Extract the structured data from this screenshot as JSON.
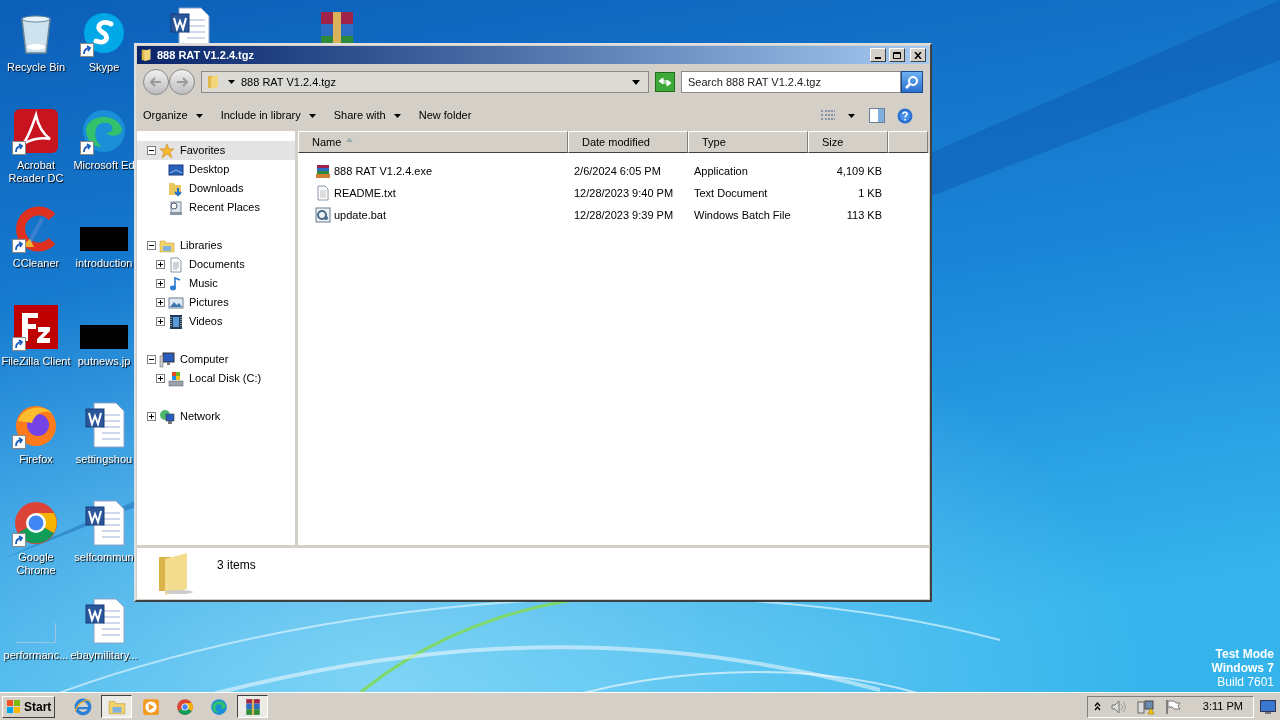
{
  "desktop": {
    "icons": [
      {
        "label": "Recycle Bin",
        "kind": "recycle-bin",
        "shortcut": false
      },
      {
        "label": "Skype",
        "kind": "skype",
        "shortcut": true
      },
      {
        "label": "Acrobat Reader DC",
        "kind": "acrobat",
        "shortcut": true
      },
      {
        "label": "Microsoft Ed",
        "kind": "edge",
        "shortcut": true
      },
      {
        "label": "CCleaner",
        "kind": "ccleaner",
        "shortcut": true
      },
      {
        "label": "introduction",
        "kind": "black",
        "shortcut": false
      },
      {
        "label": "FileZilla Client",
        "kind": "filezilla",
        "shortcut": true
      },
      {
        "label": "putnews.jp",
        "kind": "black",
        "shortcut": false
      },
      {
        "label": "Firefox",
        "kind": "firefox",
        "shortcut": true
      },
      {
        "label": "settingshou",
        "kind": "word",
        "shortcut": false
      },
      {
        "label": "Google Chrome",
        "kind": "chrome",
        "shortcut": true
      },
      {
        "label": "selfcommun",
        "kind": "word",
        "shortcut": false
      },
      {
        "label": "performanc...",
        "kind": "blank",
        "shortcut": false
      },
      {
        "label": "ebaymilitary...",
        "kind": "word",
        "shortcut": false
      }
    ],
    "covered_icons": [
      {
        "kind": "word"
      },
      {
        "kind": "winrar"
      }
    ],
    "os_notice": [
      {
        "text": "Test Mode",
        "bold": true
      },
      {
        "text": "Windows 7",
        "bold": true
      },
      {
        "text": "Build 7601",
        "bold": false
      }
    ]
  },
  "window": {
    "title": "888 RAT V1.2.4.tgz",
    "address": "888 RAT V1.2.4.tgz",
    "search": {
      "placeholder": "Search 888 RAT V1.2.4.tgz"
    },
    "toolbar": [
      {
        "label": "Organize",
        "menu": true
      },
      {
        "label": "Include in library",
        "menu": true
      },
      {
        "label": "Share with",
        "menu": true
      },
      {
        "label": "New folder",
        "menu": false
      }
    ],
    "tree": [
      {
        "label": "Favorites",
        "kind": "star",
        "expanded": true,
        "selected": true,
        "children": [
          {
            "label": "Desktop",
            "kind": "desktop",
            "selected": false
          },
          {
            "label": "Downloads",
            "kind": "downloads",
            "selected": false
          },
          {
            "label": "Recent Places",
            "kind": "recent",
            "selected": false
          }
        ]
      },
      {
        "label": "Libraries",
        "kind": "libraries",
        "expanded": true,
        "selected": false,
        "children": [
          {
            "label": "Documents",
            "kind": "documents",
            "expanded": false,
            "selected": false
          },
          {
            "label": "Music",
            "kind": "music",
            "expanded": false,
            "selected": false
          },
          {
            "label": "Pictures",
            "kind": "pictures",
            "expanded": false,
            "selected": false
          },
          {
            "label": "Videos",
            "kind": "videos",
            "expanded": false,
            "selected": false
          }
        ]
      },
      {
        "label": "Computer",
        "kind": "computer",
        "expanded": true,
        "selected": false,
        "children": [
          {
            "label": "Local Disk (C:)",
            "kind": "disk",
            "expanded": false,
            "selected": false
          }
        ]
      },
      {
        "label": "Network",
        "kind": "network",
        "expanded": false,
        "selected": false
      }
    ],
    "columns": [
      {
        "label": "Name",
        "sorted": true
      },
      {
        "label": "Date modified",
        "sorted": false
      },
      {
        "label": "Type",
        "sorted": false
      },
      {
        "label": "Size",
        "sorted": false
      }
    ],
    "files": [
      {
        "name": "888 RAT V1.2.4.exe",
        "date": "2/6/2024 6:05 PM",
        "type": "Application",
        "size": "4,109 KB",
        "kind": "archive-exe"
      },
      {
        "name": "README.txt",
        "date": "12/28/2023 9:40 PM",
        "type": "Text Document",
        "size": "1 KB",
        "kind": "text"
      },
      {
        "name": "update.bat",
        "date": "12/28/2023 9:39 PM",
        "type": "Windows Batch File",
        "size": "113 KB",
        "kind": "batch"
      }
    ],
    "status": "3 items"
  },
  "taskbar": {
    "start": "Start",
    "apps": [
      {
        "kind": "ie",
        "active": false
      },
      {
        "kind": "explorer",
        "active": true
      },
      {
        "kind": "media",
        "active": false
      },
      {
        "kind": "chrome",
        "active": false
      },
      {
        "kind": "edge",
        "active": false
      },
      {
        "kind": "winrar",
        "active": true
      }
    ],
    "clock": "3:11 PM"
  }
}
